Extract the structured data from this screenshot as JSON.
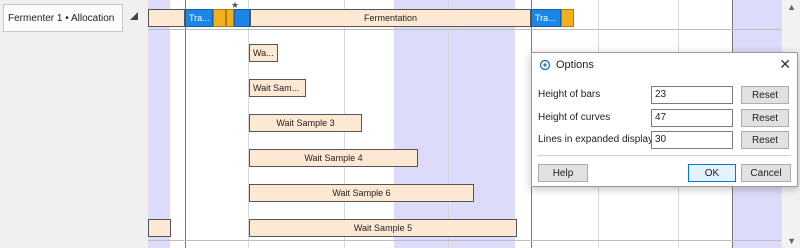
{
  "left_panel": {
    "row_header_label": "Fermenter 1 • Allocation"
  },
  "timeline": {
    "top_row": {
      "segments": [
        "Tra...",
        "Fermentation",
        "Tra..."
      ]
    },
    "samples": [
      "Wa...",
      "Wait Sam...",
      "Wait Sample 3",
      "Wait Sample 4",
      "Wait Sample 6",
      "Wait Sample 5"
    ]
  },
  "dialog": {
    "title": "Options",
    "close_glyph": "✕",
    "fields": [
      {
        "label": "Height of bars",
        "value": "23",
        "reset_label": "Reset"
      },
      {
        "label": "Height of curves",
        "value": "47",
        "reset_label": "Reset"
      },
      {
        "label": "Lines in expanded display",
        "value": "30",
        "reset_label": "Reset"
      }
    ],
    "help_label": "Help",
    "ok_label": "OK",
    "cancel_label": "Cancel"
  },
  "scroll": {
    "up_glyph": "▲",
    "down_glyph": "▼"
  },
  "colors": {
    "bar_fill": "#fde8d3",
    "transfer_blue": "#1c86e6",
    "amber": "#f2b01e",
    "shade": "#dcdcfa"
  }
}
